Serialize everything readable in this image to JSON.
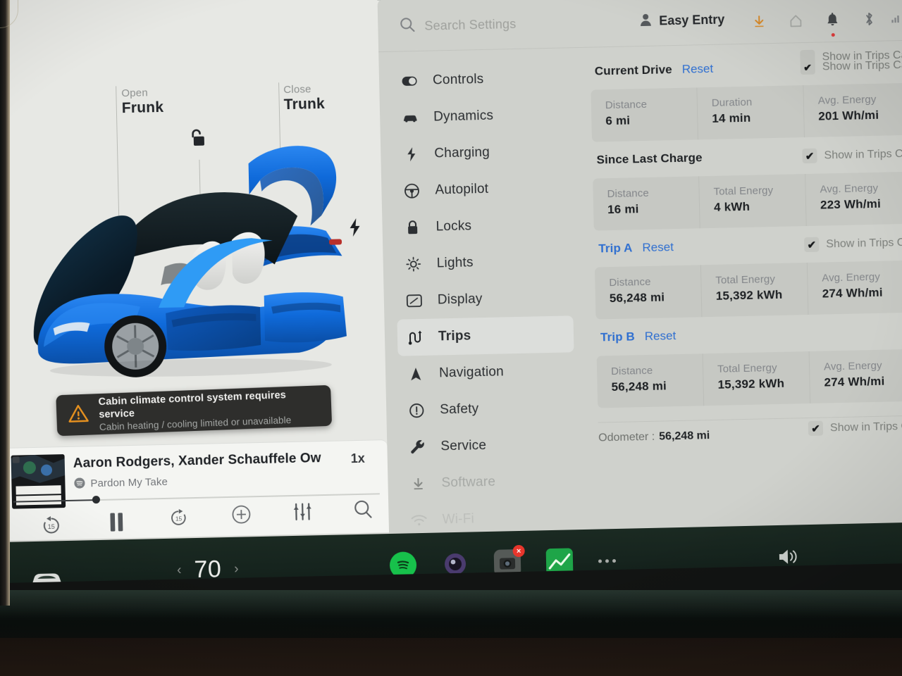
{
  "settings": {
    "search": {
      "placeholder": "Search Settings",
      "icon": "search-icon"
    },
    "profile": {
      "name": "Easy Entry",
      "icon": "person-icon"
    },
    "status_icons": [
      {
        "name": "download-icon",
        "glyph": "↓",
        "color": "#d98b2b"
      },
      {
        "name": "home-icon",
        "glyph": "⌂",
        "color": "#9b9e9a"
      },
      {
        "name": "bell-icon",
        "glyph": "\u0001",
        "color": "#44484b",
        "badge": true
      },
      {
        "name": "bluetooth-icon",
        "glyph": "\u0002",
        "color": "#6f7376"
      }
    ],
    "sidebar": {
      "items": [
        {
          "label": "Controls",
          "icon": "toggle-icon",
          "active": false
        },
        {
          "label": "Dynamics",
          "icon": "car-icon",
          "active": false
        },
        {
          "label": "Charging",
          "icon": "bolt-icon",
          "active": false
        },
        {
          "label": "Autopilot",
          "icon": "steering-wheel-icon",
          "active": false
        },
        {
          "label": "Locks",
          "icon": "lock-icon",
          "active": false
        },
        {
          "label": "Lights",
          "icon": "lights-icon",
          "active": false
        },
        {
          "label": "Display",
          "icon": "display-icon",
          "active": false
        },
        {
          "label": "Trips",
          "icon": "trips-icon",
          "active": true
        },
        {
          "label": "Navigation",
          "icon": "navigation-arrow-icon",
          "active": false
        },
        {
          "label": "Safety",
          "icon": "alert-circle-icon",
          "active": false
        },
        {
          "label": "Service",
          "icon": "wrench-icon",
          "active": false
        },
        {
          "label": "Software",
          "icon": "download-icon",
          "active": false
        },
        {
          "label": "Wi-Fi",
          "icon": "wifi-icon",
          "active": false
        }
      ]
    },
    "trips": {
      "checkbox_label": "Show in Trips Ca",
      "reset_label": "Reset",
      "sections": [
        {
          "title": "Current Drive",
          "has_reset": true,
          "title_is_link": false,
          "checked": true,
          "cells": [
            {
              "label": "Distance",
              "value": "6 mi"
            },
            {
              "label": "Duration",
              "value": "14 min"
            },
            {
              "label": "Avg. Energy",
              "value": "201 Wh/mi"
            }
          ]
        },
        {
          "title": "Since Last Charge",
          "has_reset": false,
          "title_is_link": false,
          "checked": true,
          "cells": [
            {
              "label": "Distance",
              "value": "16 mi"
            },
            {
              "label": "Total Energy",
              "value": "4 kWh"
            },
            {
              "label": "Avg. Energy",
              "value": "223 Wh/mi"
            }
          ]
        },
        {
          "title": "Trip A",
          "has_reset": true,
          "title_is_link": true,
          "checked": true,
          "cells": [
            {
              "label": "Distance",
              "value": "56,248 mi"
            },
            {
              "label": "Total Energy",
              "value": "15,392 kWh"
            },
            {
              "label": "Avg. Energy",
              "value": "274 Wh/mi"
            }
          ]
        },
        {
          "title": "Trip B",
          "has_reset": true,
          "title_is_link": true,
          "checked": false,
          "cells": [
            {
              "label": "Distance",
              "value": "56,248 mi"
            },
            {
              "label": "Total Energy",
              "value": "15,392 kWh"
            },
            {
              "label": "Avg. Energy",
              "value": "274 Wh/mi"
            }
          ]
        }
      ],
      "odometer_label": "Odometer :",
      "odometer_value": "56,248 mi",
      "odometer_checked": true
    }
  },
  "car_panel": {
    "frunk": {
      "action": "Open",
      "name": "Frunk"
    },
    "trunk": {
      "action": "Close",
      "name": "Trunk"
    },
    "lock_icon": "unlocked-lock-icon",
    "charge_icon": "charge-port-bolt-icon",
    "car_color": "#1068e0"
  },
  "alert": {
    "icon": "warning-triangle-icon",
    "title": "Cabin climate control system requires service",
    "subtitle": "Cabin heating / cooling limited or unavailable",
    "accent": "#e8921f"
  },
  "media": {
    "title": "Aaron Rodgers, Xander Schauffele Ow",
    "show": "Pardon My Take",
    "source_icon": "spotify-icon",
    "speed": "1x",
    "album_art_text_1": "PARDON MY",
    "album_art_text_2": "TAKE",
    "controls": [
      {
        "name": "rewind-15-icon",
        "label": "15"
      },
      {
        "name": "pause-icon",
        "label": ""
      },
      {
        "name": "forward-15-icon",
        "label": "15"
      },
      {
        "name": "add-icon",
        "label": ""
      },
      {
        "name": "equalizer-icon",
        "label": ""
      },
      {
        "name": "search-icon",
        "label": ""
      }
    ]
  },
  "dock": {
    "car_icon": "car-front-icon",
    "temperature": "70",
    "temp_down": "‹",
    "temp_up": "›",
    "apps": [
      {
        "name": "spotify-app-icon",
        "kind": "spotify"
      },
      {
        "name": "browser-app-icon",
        "kind": "orb"
      },
      {
        "name": "camera-app-icon",
        "kind": "cam",
        "badge": "×"
      },
      {
        "name": "toybox-app-icon",
        "kind": "toybox"
      },
      {
        "name": "more-apps-icon",
        "kind": "dots"
      }
    ],
    "volume_icon": "volume-icon"
  }
}
